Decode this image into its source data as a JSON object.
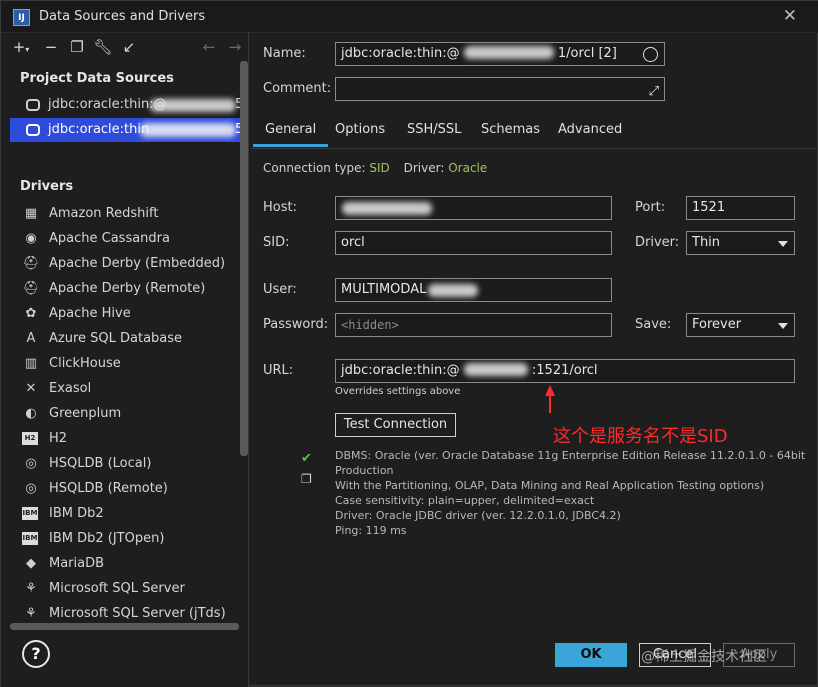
{
  "window": {
    "app_icon": "IJ",
    "title": "Data Sources and Drivers"
  },
  "left": {
    "project_header": "Project Data Sources",
    "data_sources": [
      {
        "label": "jdbc:oracle:thin:@",
        "suffix": "5"
      },
      {
        "label": "jdbc:oracle:thin",
        "suffix": "5"
      }
    ],
    "drivers_header": "Drivers",
    "drivers": [
      {
        "label": "Amazon Redshift",
        "icon": "amazon-redshift-icon",
        "glyph": "▦"
      },
      {
        "label": "Apache Cassandra",
        "icon": "cassandra-icon",
        "glyph": "◉"
      },
      {
        "label": "Apache Derby (Embedded)",
        "icon": "derby-hat-icon",
        "glyph": "⛑"
      },
      {
        "label": "Apache Derby (Remote)",
        "icon": "derby-hat-icon",
        "glyph": "⛑"
      },
      {
        "label": "Apache Hive",
        "icon": "hive-icon",
        "glyph": "✿"
      },
      {
        "label": "Azure SQL Database",
        "icon": "azure-icon",
        "glyph": "A"
      },
      {
        "label": "ClickHouse",
        "icon": "clickhouse-icon",
        "glyph": "▥"
      },
      {
        "label": "Exasol",
        "icon": "exasol-icon",
        "glyph": "✕"
      },
      {
        "label": "Greenplum",
        "icon": "greenplum-icon",
        "glyph": "◐"
      },
      {
        "label": "H2",
        "icon": "h2-icon",
        "glyph": "H2",
        "box": true
      },
      {
        "label": "HSQLDB (Local)",
        "icon": "hsqldb-icon",
        "glyph": "◎"
      },
      {
        "label": "HSQLDB (Remote)",
        "icon": "hsqldb-icon",
        "glyph": "◎"
      },
      {
        "label": "IBM Db2",
        "icon": "ibm-db2-icon",
        "glyph": "IBM",
        "box": true
      },
      {
        "label": "IBM Db2 (JTOpen)",
        "icon": "ibm-db2-icon",
        "glyph": "IBM",
        "box": true
      },
      {
        "label": "MariaDB",
        "icon": "mariadb-icon",
        "glyph": "◆"
      },
      {
        "label": "Microsoft SQL Server",
        "icon": "sql-server-icon",
        "glyph": "⚘"
      },
      {
        "label": "Microsoft SQL Server (jTds)",
        "icon": "sql-server-icon",
        "glyph": "⚘"
      }
    ]
  },
  "form": {
    "name_label": "Name:",
    "name_value_prefix": "jdbc:oracle:thin:@",
    "name_value_suffix": "1/orcl [2]",
    "comment_label": "Comment:",
    "comment_value": "",
    "tabs": [
      "General",
      "Options",
      "SSH/SSL",
      "Schemas",
      "Advanced"
    ],
    "connection_type_label": "Connection type:",
    "connection_type_value": "SID",
    "driver_info_label": "Driver:",
    "driver_info_value": "Oracle",
    "host_label": "Host:",
    "host_value": "",
    "port_label": "Port:",
    "port_value": "1521",
    "sid_label": "SID:",
    "sid_value": "orcl",
    "driver_label": "Driver:",
    "driver_value": "Thin",
    "user_label": "User:",
    "user_value": "MULTIMODAL",
    "password_label": "Password:",
    "password_placeholder": "<hidden>",
    "save_label": "Save:",
    "save_value": "Forever",
    "url_label": "URL:",
    "url_prefix": "jdbc:oracle:thin:@",
    "url_suffix": ":1521/orcl",
    "url_hint": "Overrides settings above",
    "test_connection": "Test Connection"
  },
  "status": {
    "lines": [
      "DBMS: Oracle (ver. Oracle Database 11g Enterprise Edition Release 11.2.0.1.0 - 64bit",
      "Production",
      "With the Partitioning, OLAP, Data Mining and Real Application Testing options)",
      "Case sensitivity: plain=upper, delimited=exact",
      "Driver: Oracle JDBC driver (ver. 12.2.0.1.0, JDBC4.2)",
      "Ping: 119 ms"
    ]
  },
  "annotation": "这个是服务名不是SID",
  "buttons": {
    "ok": "OK",
    "cancel": "Cancel",
    "apply": "Apply",
    "help": "?"
  },
  "watermark": "@稀土掘金技术社区",
  "colors": {
    "accent": "#3aa6d8",
    "selection": "#2f4bd9",
    "annotation": "#ff2a2a",
    "info_green": "#9fc65a"
  }
}
